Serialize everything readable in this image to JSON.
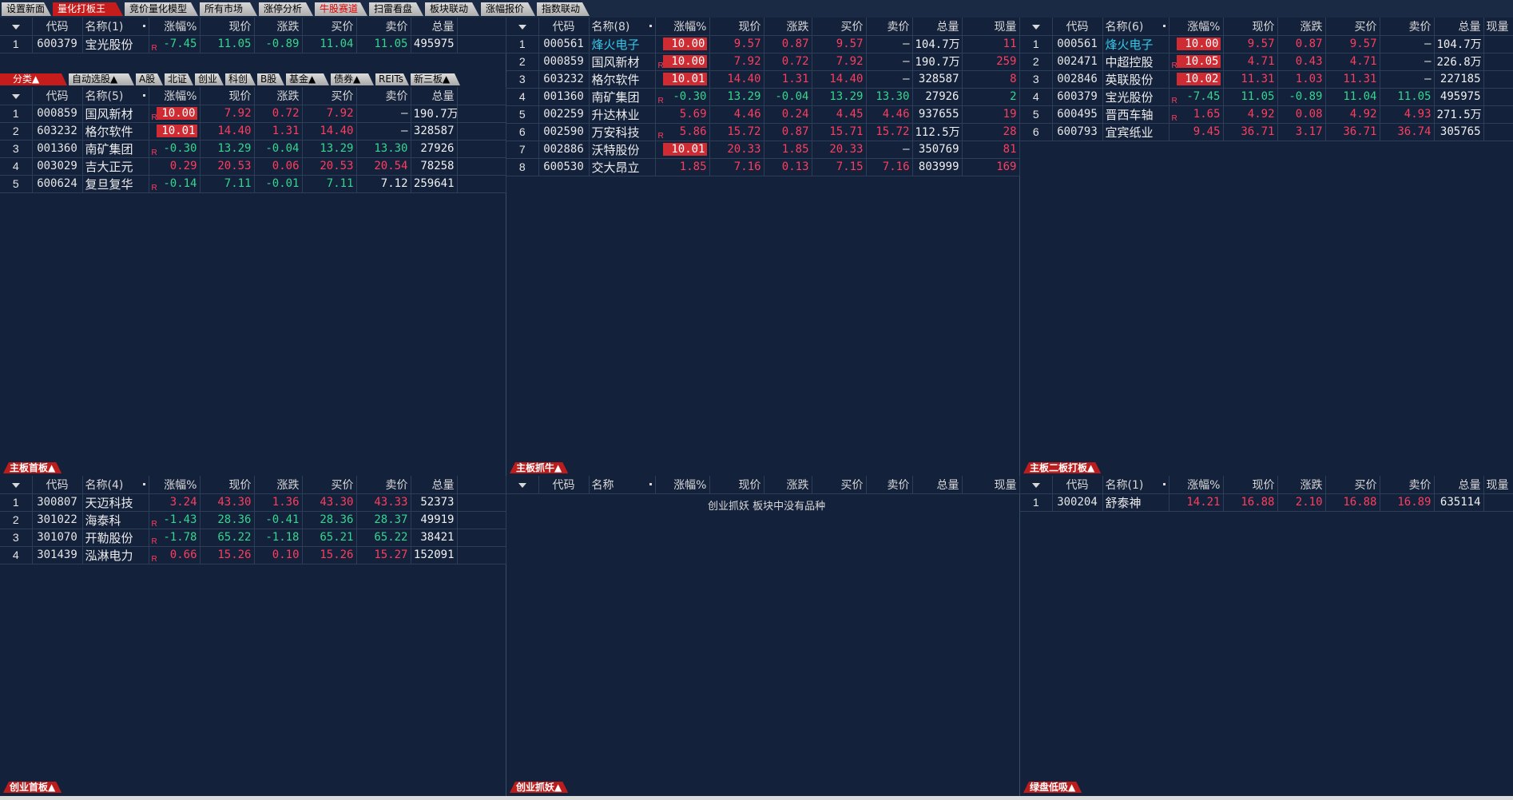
{
  "top_tabs": [
    {
      "label": "设置新面"
    },
    {
      "label": "量化打板王"
    },
    {
      "label": "竞价量化模型"
    },
    {
      "label": "所有市场"
    },
    {
      "label": "涨停分析"
    },
    {
      "label": "牛股赛道"
    },
    {
      "label": "扫雷看盘"
    },
    {
      "label": "板块联动"
    },
    {
      "label": "涨幅报价"
    },
    {
      "label": "指数联动"
    }
  ],
  "columns": {
    "code": "代码",
    "pct": "涨幅%",
    "price": "现价",
    "change": "涨跌",
    "bid": "买价",
    "ask": "卖价",
    "volume": "总量",
    "cur_vol": "现量"
  },
  "sub_tabs": [
    {
      "label": "分类▲"
    },
    {
      "label": "自动选股▲"
    },
    {
      "label": "A股"
    },
    {
      "label": "北证"
    },
    {
      "label": "创业"
    },
    {
      "label": "科创"
    },
    {
      "label": "B股"
    },
    {
      "label": "基金▲"
    },
    {
      "label": "债券▲"
    },
    {
      "label": "REITs"
    },
    {
      "label": "新三板▲"
    }
  ],
  "panels": {
    "p1": {
      "name_header": "名称(1)",
      "rows": [
        {
          "idx": "1",
          "code": "600379",
          "name": "宝光股份",
          "r": "R",
          "pct": "-7.45",
          "price": "11.05",
          "change": "-0.89",
          "bid": "11.04",
          "ask": "11.05",
          "volume": "495975"
        }
      ]
    },
    "p2": {
      "name_header": "名称(5)",
      "rows": [
        {
          "idx": "1",
          "code": "000859",
          "name": "国风新材",
          "r": "R",
          "pct": "10.00",
          "limit": true,
          "price": "7.92",
          "change": "0.72",
          "bid": "7.92",
          "ask": "–",
          "volume": "190.7万"
        },
        {
          "idx": "2",
          "code": "603232",
          "name": "格尔软件",
          "r": "",
          "pct": "10.01",
          "limit": true,
          "price": "14.40",
          "change": "1.31",
          "bid": "14.40",
          "ask": "–",
          "volume": "328587"
        },
        {
          "idx": "3",
          "code": "001360",
          "name": "南矿集团",
          "r": "R",
          "pct": "-0.30",
          "price": "13.29",
          "change": "-0.04",
          "bid": "13.29",
          "ask": "13.30",
          "volume": "27926"
        },
        {
          "idx": "4",
          "code": "003029",
          "name": "吉大正元",
          "r": "",
          "pct": "0.29",
          "price": "20.53",
          "change": "0.06",
          "bid": "20.53",
          "ask": "20.54",
          "volume": "78258"
        },
        {
          "idx": "5",
          "code": "600624",
          "name": "复旦复华",
          "r": "R",
          "pct": "-0.14",
          "price": "7.11",
          "change": "-0.01",
          "bid": "7.11",
          "ask": "7.12",
          "volume": "259641"
        }
      ]
    },
    "p3": {
      "name_header": "名称(8)",
      "rows": [
        {
          "idx": "1",
          "code": "000561",
          "name": "烽火电子",
          "hl": true,
          "r": "",
          "pct": "10.00",
          "limit": true,
          "price": "9.57",
          "change": "0.87",
          "bid": "9.57",
          "ask": "–",
          "volume": "104.7万",
          "cur_vol": "11"
        },
        {
          "idx": "2",
          "code": "000859",
          "name": "国风新材",
          "r": "R",
          "pct": "10.00",
          "limit": true,
          "price": "7.92",
          "change": "0.72",
          "bid": "7.92",
          "ask": "–",
          "volume": "190.7万",
          "cur_vol": "259"
        },
        {
          "idx": "3",
          "code": "603232",
          "name": "格尔软件",
          "r": "",
          "pct": "10.01",
          "limit": true,
          "price": "14.40",
          "change": "1.31",
          "bid": "14.40",
          "ask": "–",
          "volume": "328587",
          "cur_vol": "8"
        },
        {
          "idx": "4",
          "code": "001360",
          "name": "南矿集团",
          "r": "R",
          "pct": "-0.30",
          "price": "13.29",
          "change": "-0.04",
          "bid": "13.29",
          "ask": "13.30",
          "volume": "27926",
          "cur_vol": "2"
        },
        {
          "idx": "5",
          "code": "002259",
          "name": "升达林业",
          "r": "",
          "pct": "5.69",
          "price": "4.46",
          "change": "0.24",
          "bid": "4.45",
          "ask": "4.46",
          "volume": "937655",
          "cur_vol": "19"
        },
        {
          "idx": "6",
          "code": "002590",
          "name": "万安科技",
          "r": "R",
          "pct": "5.86",
          "price": "15.72",
          "change": "0.87",
          "bid": "15.71",
          "ask": "15.72",
          "volume": "112.5万",
          "cur_vol": "28"
        },
        {
          "idx": "7",
          "code": "002886",
          "name": "沃特股份",
          "r": "",
          "pct": "10.01",
          "limit": true,
          "price": "20.33",
          "change": "1.85",
          "bid": "20.33",
          "ask": "–",
          "volume": "350769",
          "cur_vol": "81"
        },
        {
          "idx": "8",
          "code": "600530",
          "name": "交大昂立",
          "r": "",
          "pct": "1.85",
          "price": "7.16",
          "change": "0.13",
          "bid": "7.15",
          "ask": "7.16",
          "volume": "803999",
          "cur_vol": "169"
        }
      ]
    },
    "p4": {
      "name_header": "名称(6)",
      "rows": [
        {
          "idx": "1",
          "code": "000561",
          "name": "烽火电子",
          "hl": true,
          "r": "",
          "pct": "10.00",
          "limit": true,
          "price": "9.57",
          "change": "0.87",
          "bid": "9.57",
          "ask": "–",
          "volume": "104.7万"
        },
        {
          "idx": "2",
          "code": "002471",
          "name": "中超控股",
          "r": "R",
          "pct": "10.05",
          "limit": true,
          "price": "4.71",
          "change": "0.43",
          "bid": "4.71",
          "ask": "–",
          "volume": "226.8万"
        },
        {
          "idx": "3",
          "code": "002846",
          "name": "英联股份",
          "r": "",
          "pct": "10.02",
          "limit": true,
          "price": "11.31",
          "change": "1.03",
          "bid": "11.31",
          "ask": "–",
          "volume": "227185"
        },
        {
          "idx": "4",
          "code": "600379",
          "name": "宝光股份",
          "r": "R",
          "pct": "-7.45",
          "price": "11.05",
          "change": "-0.89",
          "bid": "11.04",
          "ask": "11.05",
          "volume": "495975"
        },
        {
          "idx": "5",
          "code": "600495",
          "name": "晋西车轴",
          "r": "R",
          "pct": "1.65",
          "price": "4.92",
          "change": "0.08",
          "bid": "4.92",
          "ask": "4.93",
          "volume": "271.5万"
        },
        {
          "idx": "6",
          "code": "600793",
          "name": "宜宾纸业",
          "r": "",
          "pct": "9.45",
          "price": "36.71",
          "change": "3.17",
          "bid": "36.71",
          "ask": "36.74",
          "volume": "305765"
        }
      ]
    },
    "p5": {
      "name_header": "名称(4)",
      "rows": [
        {
          "idx": "1",
          "code": "300807",
          "name": "天迈科技",
          "r": "",
          "pct": "3.24",
          "price": "43.30",
          "change": "1.36",
          "bid": "43.30",
          "ask": "43.33",
          "volume": "52373"
        },
        {
          "idx": "2",
          "code": "301022",
          "name": "海泰科",
          "r": "R",
          "pct": "-1.43",
          "price": "28.36",
          "change": "-0.41",
          "bid": "28.36",
          "ask": "28.37",
          "volume": "49919"
        },
        {
          "idx": "3",
          "code": "301070",
          "name": "开勒股份",
          "r": "R",
          "pct": "-1.78",
          "price": "65.22",
          "change": "-1.18",
          "bid": "65.21",
          "ask": "65.22",
          "volume": "38421"
        },
        {
          "idx": "4",
          "code": "301439",
          "name": "泓淋电力",
          "r": "R",
          "pct": "0.66",
          "price": "15.26",
          "change": "0.10",
          "bid": "15.26",
          "ask": "15.27",
          "volume": "152091"
        }
      ]
    },
    "p6": {
      "name_header": "名称",
      "empty_message": "创业抓妖 板块中没有品种",
      "rows": []
    },
    "p7": {
      "name_header": "名称(1)",
      "rows": [
        {
          "idx": "1",
          "code": "300204",
          "name": "舒泰神",
          "r": "",
          "pct": "14.21",
          "price": "16.88",
          "change": "2.10",
          "bid": "16.88",
          "ask": "16.89",
          "volume": "635114"
        }
      ]
    }
  },
  "section_labels": {
    "p2": "主板首板▲",
    "p3": "主板抓牛▲",
    "p4": "主板二板打板▲",
    "p5": "创业首板▲",
    "p6": "创业抓妖▲",
    "p7": "绿盘低吸▲"
  }
}
